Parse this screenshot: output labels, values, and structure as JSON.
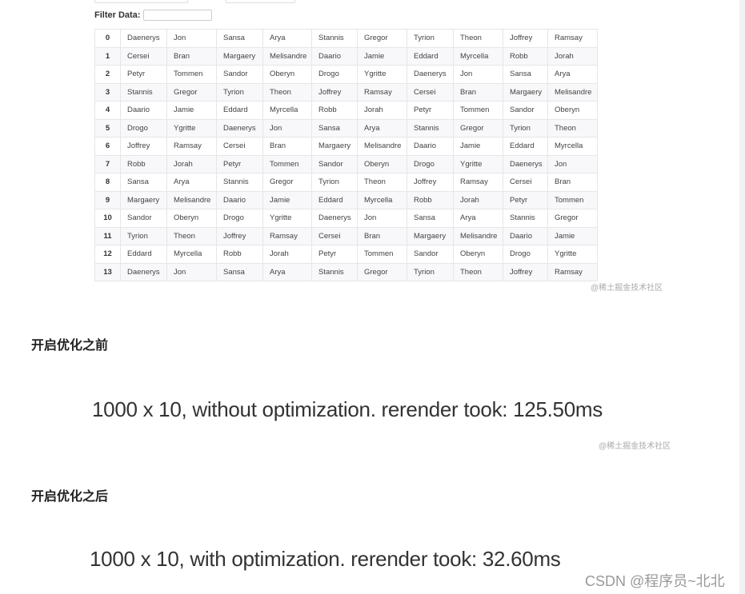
{
  "filter": {
    "label": "Filter Data:",
    "value": ""
  },
  "table": {
    "rows": [
      [
        "0",
        "Daenerys",
        "Jon",
        "Sansa",
        "Arya",
        "Stannis",
        "Gregor",
        "Tyrion",
        "Theon",
        "Joffrey",
        "Ramsay"
      ],
      [
        "1",
        "Cersei",
        "Bran",
        "Margaery",
        "Melisandre",
        "Daario",
        "Jamie",
        "Eddard",
        "Myrcella",
        "Robb",
        "Jorah"
      ],
      [
        "2",
        "Petyr",
        "Tommen",
        "Sandor",
        "Oberyn",
        "Drogo",
        "Ygritte",
        "Daenerys",
        "Jon",
        "Sansa",
        "Arya"
      ],
      [
        "3",
        "Stannis",
        "Gregor",
        "Tyrion",
        "Theon",
        "Joffrey",
        "Ramsay",
        "Cersei",
        "Bran",
        "Margaery",
        "Melisandre"
      ],
      [
        "4",
        "Daario",
        "Jamie",
        "Eddard",
        "Myrcella",
        "Robb",
        "Jorah",
        "Petyr",
        "Tommen",
        "Sandor",
        "Oberyn"
      ],
      [
        "5",
        "Drogo",
        "Ygritte",
        "Daenerys",
        "Jon",
        "Sansa",
        "Arya",
        "Stannis",
        "Gregor",
        "Tyrion",
        "Theon"
      ],
      [
        "6",
        "Joffrey",
        "Ramsay",
        "Cersei",
        "Bran",
        "Margaery",
        "Melisandre",
        "Daario",
        "Jamie",
        "Eddard",
        "Myrcella"
      ],
      [
        "7",
        "Robb",
        "Jorah",
        "Petyr",
        "Tommen",
        "Sandor",
        "Oberyn",
        "Drogo",
        "Ygritte",
        "Daenerys",
        "Jon"
      ],
      [
        "8",
        "Sansa",
        "Arya",
        "Stannis",
        "Gregor",
        "Tyrion",
        "Theon",
        "Joffrey",
        "Ramsay",
        "Cersei",
        "Bran"
      ],
      [
        "9",
        "Margaery",
        "Melisandre",
        "Daario",
        "Jamie",
        "Eddard",
        "Myrcella",
        "Robb",
        "Jorah",
        "Petyr",
        "Tommen"
      ],
      [
        "10",
        "Sandor",
        "Oberyn",
        "Drogo",
        "Ygritte",
        "Daenerys",
        "Jon",
        "Sansa",
        "Arya",
        "Stannis",
        "Gregor"
      ],
      [
        "11",
        "Tyrion",
        "Theon",
        "Joffrey",
        "Ramsay",
        "Cersei",
        "Bran",
        "Margaery",
        "Melisandre",
        "Daario",
        "Jamie"
      ],
      [
        "12",
        "Eddard",
        "Myrcella",
        "Robb",
        "Jorah",
        "Petyr",
        "Tommen",
        "Sandor",
        "Oberyn",
        "Drogo",
        "Ygritte"
      ],
      [
        "13",
        "Daenerys",
        "Jon",
        "Sansa",
        "Arya",
        "Stannis",
        "Gregor",
        "Tyrion",
        "Theon",
        "Joffrey",
        "Ramsay"
      ]
    ]
  },
  "watermark1": "@稀土掘金技术社区",
  "before_heading": "开启优化之前",
  "before_result": "1000 x 10, without optimization. rerender took: 125.50ms",
  "watermark2": "@稀土掘金技术社区",
  "after_heading": "开启优化之后",
  "after_result": "1000 x 10, with optimization. rerender took: 32.60ms",
  "csdn_watermark": "CSDN @程序员~北北"
}
